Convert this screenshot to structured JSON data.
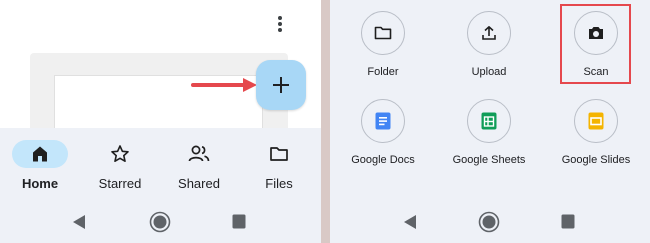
{
  "left_screen": {
    "fab_symbol": "+",
    "annotation_color": "#e5484d",
    "bottom_nav": [
      {
        "label": "Home",
        "icon": "home-icon",
        "active": true
      },
      {
        "label": "Starred",
        "icon": "star-icon",
        "active": false
      },
      {
        "label": "Shared",
        "icon": "people-icon",
        "active": false
      },
      {
        "label": "Files",
        "icon": "folder-icon",
        "active": false
      }
    ]
  },
  "right_screen": {
    "actions": [
      {
        "label": "Folder",
        "icon": "folder-icon"
      },
      {
        "label": "Upload",
        "icon": "upload-icon"
      },
      {
        "label": "Scan",
        "icon": "camera-icon",
        "highlighted": true
      },
      {
        "label": "Google Docs",
        "icon": "google-docs-icon",
        "color": "#4285f4"
      },
      {
        "label": "Google Sheets",
        "icon": "google-sheets-icon",
        "color": "#0f9d58"
      },
      {
        "label": "Google Slides",
        "icon": "google-slides-icon",
        "color": "#f4b400"
      }
    ]
  },
  "colors": {
    "nav_background": "#eef1f7",
    "fab_background": "#a8d7f6",
    "active_pill": "#c3e6fb",
    "highlight_border": "#e5484d"
  }
}
